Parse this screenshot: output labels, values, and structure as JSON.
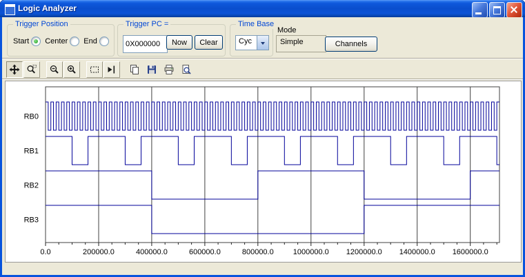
{
  "window": {
    "title": "Logic Analyzer"
  },
  "trigger_position": {
    "label": "Trigger Position",
    "options": [
      {
        "label": "Start",
        "selected": true
      },
      {
        "label": "Center",
        "selected": false
      },
      {
        "label": "End",
        "selected": false
      }
    ]
  },
  "trigger_pc": {
    "label": "Trigger PC =",
    "value": "0X000000",
    "now": "Now",
    "clear": "Clear"
  },
  "time_base": {
    "label": "Time Base",
    "value": "Cyc"
  },
  "mode": {
    "label": "Mode",
    "value": "Simple"
  },
  "channels_button_label": "Channels",
  "toolbar_buttons": [
    "pan",
    "zoom-window",
    "zoom-out",
    "zoom-in",
    "select-region",
    "marker",
    "copy",
    "save",
    "print",
    "print-preview"
  ],
  "chart_data": {
    "type": "line",
    "subtype": "digital-timing",
    "x_range": [
      0,
      1710000
    ],
    "x_major_tick_interval": 200000,
    "x_minor_tick_interval": 50000,
    "x_tick_labels": [
      "0.0",
      "200000.0",
      "400000.0",
      "600000.0",
      "800000.0",
      "1000000.0",
      "1200000.0",
      "1400000.0",
      "1600000.0"
    ],
    "grid": "vertical-major",
    "trace_color": "#000099",
    "grid_color": "#404040",
    "channels": [
      {
        "name": "RB0",
        "initial": 1,
        "clock_half_period": 10000
      },
      {
        "name": "RB1",
        "initial": 1,
        "edges": [
          100000,
          160000,
          300000,
          360000,
          500000,
          560000,
          700000,
          760000,
          900000,
          960000,
          1100000,
          1160000,
          1300000,
          1360000,
          1500000,
          1560000,
          1700000
        ]
      },
      {
        "name": "RB2",
        "initial": 1,
        "edges": [
          400000,
          800000,
          1200000,
          1600000
        ]
      },
      {
        "name": "RB3",
        "initial": 1,
        "edges": [
          400000,
          1200000
        ]
      }
    ]
  }
}
